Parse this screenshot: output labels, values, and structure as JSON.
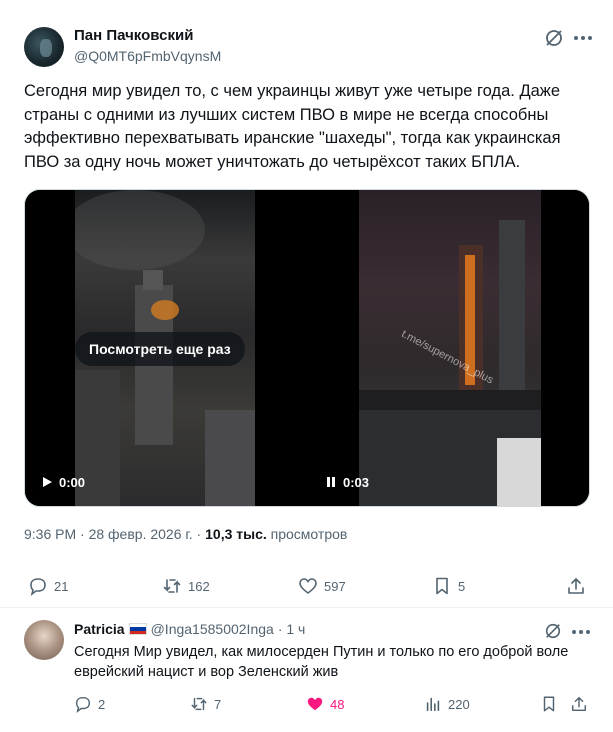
{
  "post": {
    "author_name": "Пан Пачковский",
    "author_handle": "@Q0MT6pFmbVqynsM",
    "text": "Сегодня мир увидел то, с чем украинцы живут уже четыре года. Даже страны с одними из лучших систем ПВО в мире не всегда способны эффективно перехватывать иранские \"шахеды\", тогда как украинская ПВО за одну ночь может уничтожать до четырёхсот таких БПЛА.",
    "media": {
      "left_video": {
        "overlay_label": "Посмотреть еще раз",
        "time": "0:00",
        "state_icon": "play-icon"
      },
      "right_video": {
        "time": "0:03",
        "state_icon": "pause-icon",
        "watermark": "t.me/supernova_plus"
      }
    },
    "timestamp": "9:36 PM · 28 февр. 2026 г. ·",
    "views_count": "10,3 тыс.",
    "views_label": "просмотров",
    "actions": {
      "replies": "21",
      "reposts": "162",
      "likes": "597",
      "bookmarks": "5"
    }
  },
  "reply": {
    "author_name": "Patricia",
    "author_handle": "@Inga1585002Inga",
    "time": "· 1 ч",
    "text": "Сегодня Мир увидел, как милосерден Путин и только по его доброй воле еврейский нацист и вор Зеленский жив",
    "actions": {
      "replies": "2",
      "reposts": "7",
      "likes": "48",
      "views": "220"
    }
  },
  "colors": {
    "text_primary": "#0f1419",
    "text_secondary": "#536471",
    "like_active": "#f91880",
    "divider": "#eff3f4"
  }
}
